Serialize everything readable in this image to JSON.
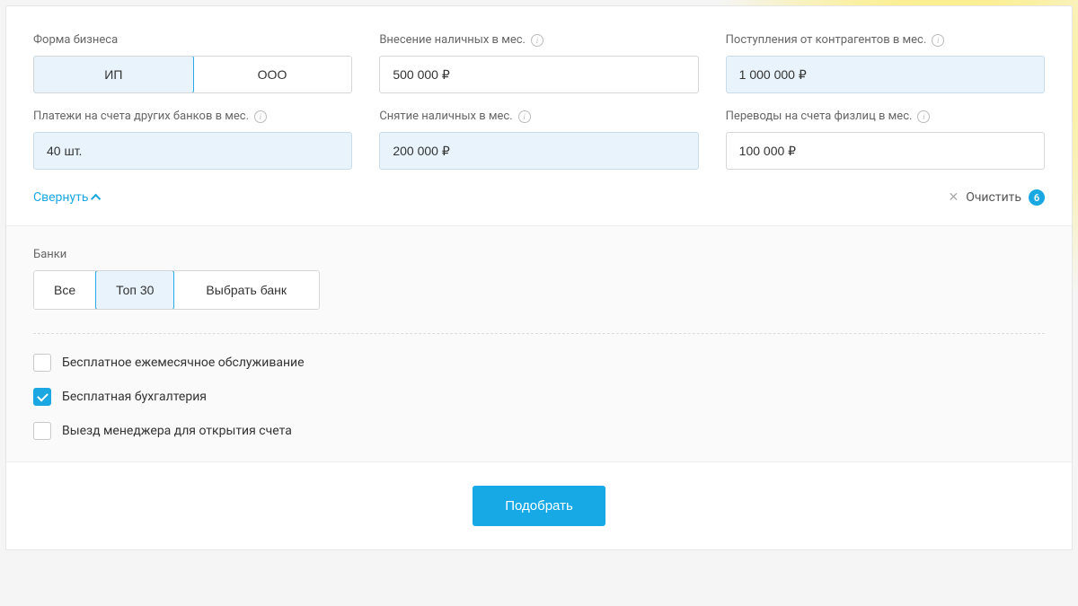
{
  "form": {
    "business_form": {
      "label": "Форма бизнеса",
      "opt_ip": "ИП",
      "opt_ooo": "ООО"
    },
    "cash_deposit": {
      "label": "Внесение наличных в мес.",
      "value": "500 000 ₽"
    },
    "incoming": {
      "label": "Поступления от контрагентов в мес.",
      "value": "1 000 000 ₽"
    },
    "other_bank_payments": {
      "label": "Платежи на счета других банков в мес.",
      "value": "40 шт."
    },
    "cash_withdraw": {
      "label": "Снятие наличных в мес.",
      "value": "200 000 ₽"
    },
    "transfers_indiv": {
      "label": "Переводы на счета физлиц в мес.",
      "value": "100 000 ₽"
    }
  },
  "controls": {
    "collapse": "Свернуть",
    "clear": "Очистить",
    "clear_count": "6"
  },
  "banks": {
    "label": "Банки",
    "opt_all": "Все",
    "opt_top30": "Топ 30",
    "opt_choose": "Выбрать банк"
  },
  "checkboxes": {
    "free_service": "Бесплатное ежемесячное обслуживание",
    "free_accounting": "Бесплатная бухгалтерия",
    "manager_visit": "Выезд менеджера для открытия счета"
  },
  "submit": "Подобрать"
}
